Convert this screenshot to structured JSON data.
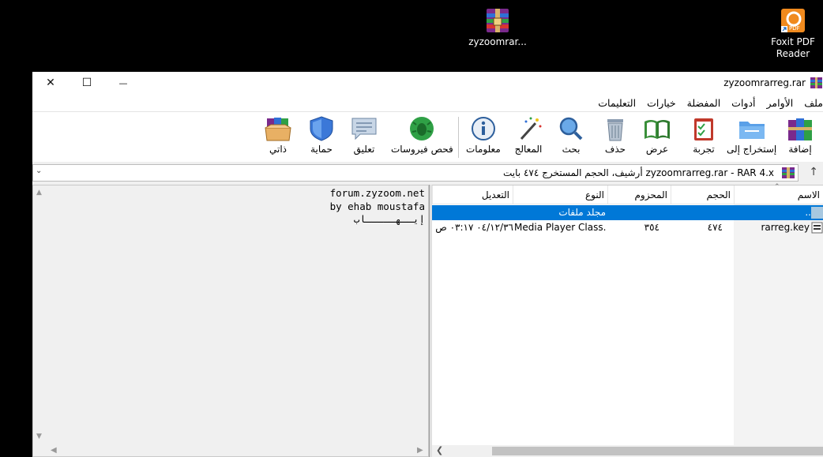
{
  "desktop": {
    "icons": [
      {
        "label": "zyzoomrar...",
        "icon": "winrar-archive-icon"
      },
      {
        "label": "Foxit PDF Reader",
        "icon": "foxit-reader-icon"
      }
    ]
  },
  "window": {
    "title": "zyzoomrarreg.rar",
    "controls": {
      "close": "✕",
      "maximize": "☐",
      "minimize": "—"
    }
  },
  "menu": [
    "ملف",
    "الأوامر",
    "أدوات",
    "المفضلة",
    "خيارات",
    "التعليمات"
  ],
  "toolbar": {
    "add": "إضافة",
    "extract": "إستخراج إلى",
    "test": "تجربة",
    "view": "عرض",
    "delete": "حذف",
    "find": "بحث",
    "wizard": "المعالج",
    "info": "معلومات",
    "virus_scan": "فحص فيروسات",
    "comment": "تعليق",
    "protect": "حماية",
    "sfx": "ذاتي"
  },
  "address": {
    "text": "zyzoomrarreg.rar - RAR 4.x أرشيف، الحجم المستخرج ٤٧٤ بايت"
  },
  "comment": {
    "text": "forum.zyzoom.net\nby ehab moustafa\nإيــهـــــاب"
  },
  "filelist": {
    "columns": {
      "name": "الاسم",
      "size": "الحجم",
      "packed": "المحزوم",
      "type": "النوع",
      "modified": "التعديل"
    },
    "rows": [
      {
        "name": "..",
        "size": "",
        "packed": "",
        "type": "مجلد ملفات",
        "modified": ""
      },
      {
        "name": "rarreg.key",
        "size": "٤٧٤",
        "packed": "٣٥٤",
        "type": "Media Player Class...",
        "modified": "٠٤/١٢/٣٦ ٠٣:١٧ ص"
      }
    ]
  },
  "colors": {
    "selection": "#0078d7",
    "window_bg": "#f0f0f0",
    "desktop_bg": "#000000"
  }
}
